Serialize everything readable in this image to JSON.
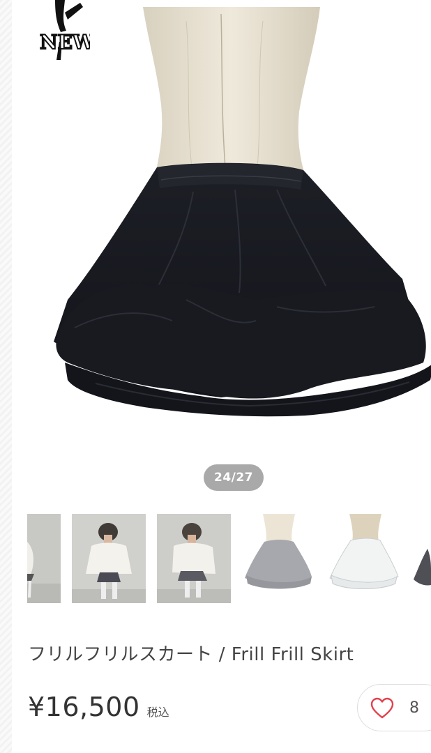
{
  "gallery": {
    "counter": "24/27",
    "thumbnails": [
      {
        "name": "model-front-partial",
        "bg": "#c9c9c6"
      },
      {
        "name": "model-front-pose",
        "bg": "#cfcfcb"
      },
      {
        "name": "model-side-pose",
        "bg": "#cdcdca"
      },
      {
        "name": "grey-skirt-mannequin",
        "bg": "#ffffff"
      },
      {
        "name": "white-skirt-mannequin",
        "bg": "#ffffff"
      },
      {
        "name": "dark-skirt-mannequin-partial",
        "bg": "#ffffff"
      }
    ]
  },
  "logo": {
    "text": "NEW",
    "icon": "dancer-silhouette-logo"
  },
  "product": {
    "title": "フリルフリルスカート / Frill Frill Skirt",
    "price": "¥16,500",
    "tax_label": "税込"
  },
  "favorite": {
    "icon": "heart-outline-icon",
    "count": "8",
    "color": "#e0424d"
  }
}
